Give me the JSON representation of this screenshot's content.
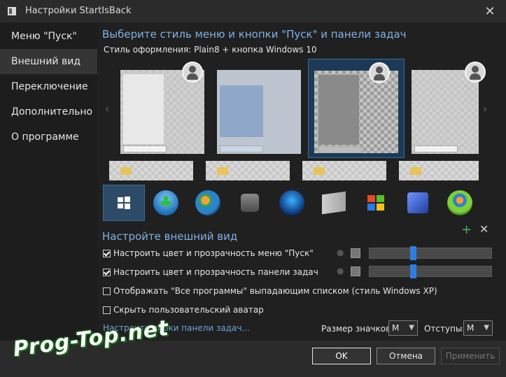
{
  "window": {
    "title": "Настройки StartIsBack",
    "close_glyph": "✕"
  },
  "sidebar": {
    "items": [
      {
        "label": "Меню \"Пуск\""
      },
      {
        "label": "Внешний вид",
        "active": true
      },
      {
        "label": "Переключение"
      },
      {
        "label": "Дополнительно"
      },
      {
        "label": "О программе"
      }
    ]
  },
  "style_section": {
    "heading": "Выберите стиль меню и кнопки \"Пуск\" и панели задач",
    "style_line": "Стиль оформления:  Plain8 + кнопка Windows 10",
    "selected_style_index": 2,
    "orbs": [
      {
        "name": "windows10-orb",
        "color": "#2b4f73"
      },
      {
        "name": "clover-orb",
        "color": "#1f7fc4"
      },
      {
        "name": "windows7-orb",
        "color": "#2a84c8"
      },
      {
        "name": "classic-orb",
        "color": "#6a6a6a"
      },
      {
        "name": "windows8-orb",
        "color": "#1a2c6e"
      },
      {
        "name": "white-flag-orb",
        "color": "#d0d0d0"
      },
      {
        "name": "xp-flag-orb",
        "color": "#3c3c3c"
      },
      {
        "name": "blue-flag-orb",
        "color": "#3f64c4"
      },
      {
        "name": "green-orb",
        "color": "#5aa02c"
      }
    ],
    "add_glyph": "+",
    "remove_glyph": "✕"
  },
  "appearance_section": {
    "heading": "Настройте внешний вид",
    "options": [
      {
        "label": "Настроить цвет и прозрачность меню \"Пуск\"",
        "checked": true,
        "transparency_fraction": 0.5
      },
      {
        "label": "Настроить цвет и прозрачность панели задач",
        "checked": true,
        "transparency_fraction": 0.5
      },
      {
        "label": "Отображать \"Все программы\" выпадающим списком (стиль Windows XP)",
        "checked": false
      },
      {
        "label": "Скрыть пользовательский аватар",
        "checked": false
      }
    ],
    "link": "Настроить перки панели задач...",
    "icon_size_label": "Размер значков:",
    "icon_size_value": "M",
    "padding_label": "Отступы:",
    "padding_value": "M"
  },
  "footer": {
    "ok": "OK",
    "cancel": "Отмена",
    "apply": "Применить"
  },
  "watermark": "Prog-Top.net",
  "colors": {
    "accent": "#7fb2e6",
    "link": "#6fa3dc",
    "slider_knob": "#2f7de0",
    "selection": "#1c3a57"
  }
}
